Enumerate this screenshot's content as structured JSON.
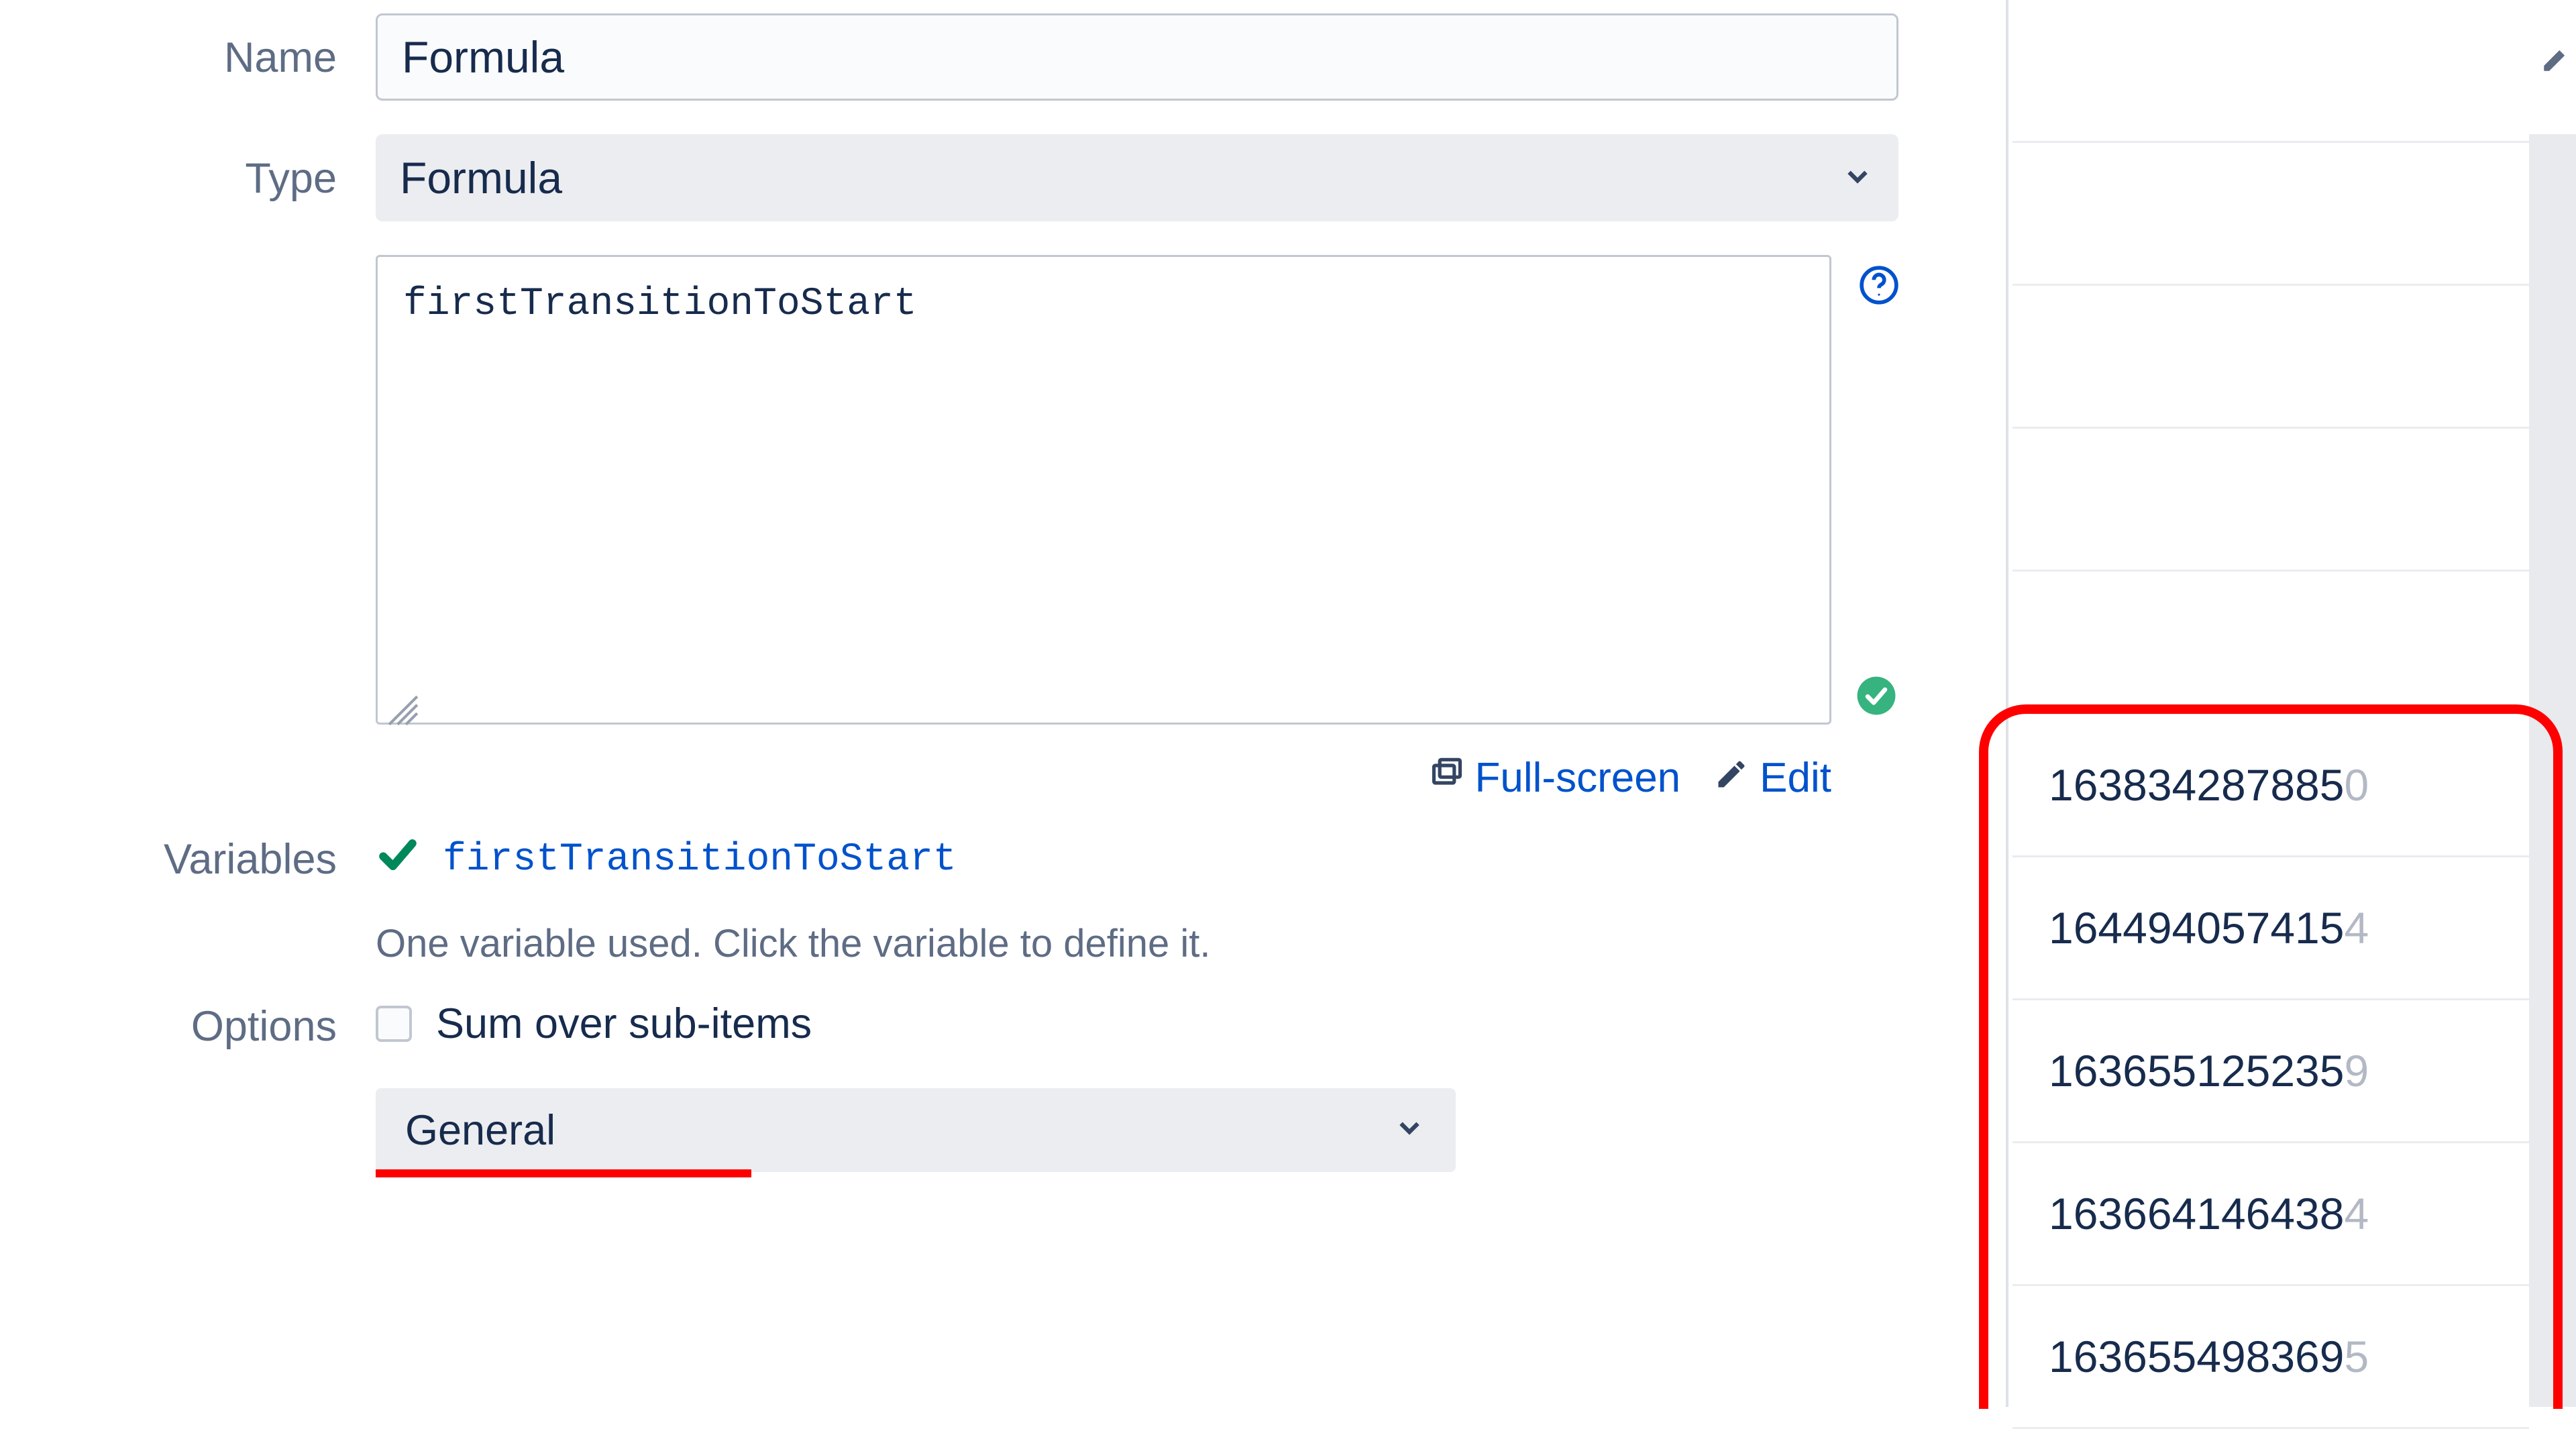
{
  "form": {
    "name_label": "Name",
    "name_value": "Formula",
    "type_label": "Type",
    "type_value": "Formula",
    "formula_text": "firstTransitionToStart",
    "fullscreen_label": "Full-screen",
    "edit_label": "Edit",
    "variables_label": "Variables",
    "variable_name": "firstTransitionToStart",
    "variable_hint": "One variable used. Click the variable to define it.",
    "options_label": "Options",
    "sum_label": "Sum over sub-items",
    "options_select_value": "General"
  },
  "results": [
    {
      "visible": "",
      "cut": ""
    },
    {
      "visible": "",
      "cut": ""
    },
    {
      "visible": "",
      "cut": ""
    },
    {
      "visible": "",
      "cut": ""
    },
    {
      "visible": "",
      "cut": ""
    },
    {
      "visible": "163834287885",
      "cut": "0"
    },
    {
      "visible": "164494057415",
      "cut": "4"
    },
    {
      "visible": "163655125235",
      "cut": "9"
    },
    {
      "visible": "163664146438",
      "cut": "4"
    },
    {
      "visible": "163655498369",
      "cut": "5"
    }
  ]
}
